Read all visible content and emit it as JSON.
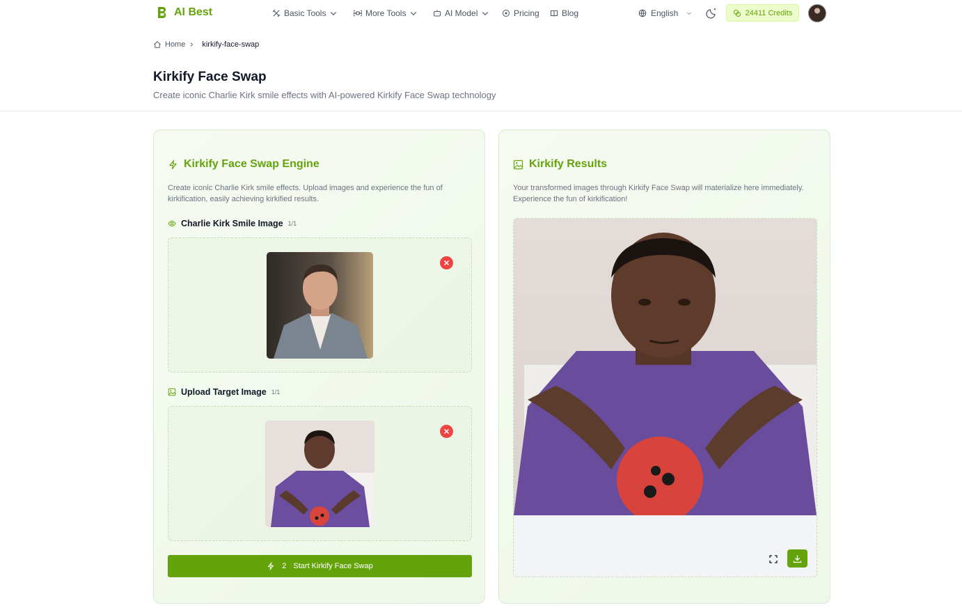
{
  "brand": {
    "name": "AI Best",
    "accent": "#65a30d"
  },
  "nav": {
    "basic_tools": "Basic Tools",
    "more_tools": "More Tools",
    "ai_model": "AI Model",
    "pricing": "Pricing",
    "blog": "Blog"
  },
  "language": "English",
  "credits": "24411 Credits",
  "breadcrumb": {
    "home": "Home",
    "current": "kirkify-face-swap"
  },
  "page": {
    "title": "Kirkify Face Swap",
    "subtitle": "Create iconic Charlie Kirk smile effects with AI-powered Kirkify Face Swap technology"
  },
  "engine": {
    "title": "Kirkify Face Swap Engine",
    "description": "Create iconic Charlie Kirk smile effects. Upload images and experience the fun of kirkification, easily achieving kirkified results.",
    "smile_label": "Charlie Kirk Smile Image",
    "smile_count": "1/1",
    "target_label": "Upload Target Image",
    "target_count": "1/1",
    "button_cost": "2",
    "button_label": "Start Kirkify Face Swap"
  },
  "results": {
    "title": "Kirkify Results",
    "description": "Your transformed images through Kirkify Face Swap will materialize here immediately. Experience the fun of kirkification!"
  },
  "icons": {
    "logo": "logo-b-icon",
    "basic_tools": "tools-icon",
    "more_tools": "command-icon",
    "ai_model": "robot-icon",
    "pricing": "coin-icon",
    "blog": "book-icon",
    "language": "globe-icon",
    "theme": "moon-icon",
    "credits": "coins-icon",
    "engine": "bolt-icon",
    "results": "image-icon",
    "smile": "eye-icon",
    "target": "image-icon",
    "remove": "close-icon",
    "fullscreen": "fullscreen-icon",
    "download": "download-icon"
  }
}
